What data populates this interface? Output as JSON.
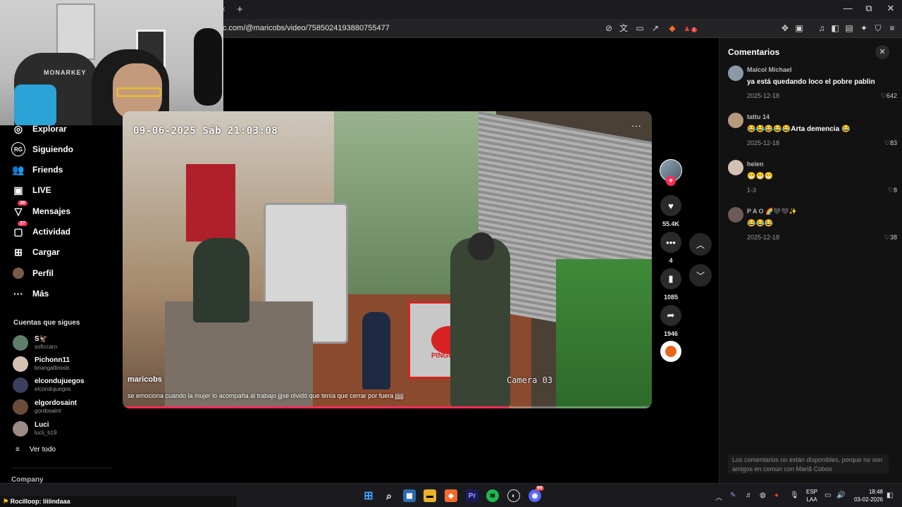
{
  "browser": {
    "url": "c.com/@maricobs/video/7585024193880755477",
    "new_tab": "+",
    "tab_close": "×",
    "window": {
      "minimize": "—",
      "restore": "⧉",
      "close": "✕"
    },
    "ext_badge": "1"
  },
  "webcam": {
    "chair_brand": "MONARKEY"
  },
  "sidebar": {
    "nav": [
      {
        "label": "Explorar",
        "icon": "compass-icon",
        "badge": ""
      },
      {
        "label": "Siguiendo",
        "icon": "following-icon",
        "badge": ""
      },
      {
        "label": "Friends",
        "icon": "friends-icon",
        "badge": ""
      },
      {
        "label": "LIVE",
        "icon": "live-icon",
        "badge": ""
      },
      {
        "label": "Mensajes",
        "icon": "messages-icon",
        "badge": "38"
      },
      {
        "label": "Actividad",
        "icon": "activity-icon",
        "badge": "37"
      },
      {
        "label": "Cargar",
        "icon": "upload-icon",
        "badge": ""
      },
      {
        "label": "Perfil",
        "icon": "profile-icon",
        "badge": ""
      },
      {
        "label": "Más",
        "icon": "more-icon",
        "badge": ""
      }
    ],
    "following_title": "Cuentas que sigues",
    "accounts": [
      {
        "name": "S🦅",
        "username": "soficcaro"
      },
      {
        "name": "Pichonn11",
        "username": "briangallinosb"
      },
      {
        "name": "elcondujuegos",
        "username": "elcondujuegos"
      },
      {
        "name": "elgordosaint",
        "username": "gordosaint"
      },
      {
        "name": "Luci",
        "username": "lucii_b19"
      }
    ],
    "see_all": "Ver todo",
    "company": "Company"
  },
  "video": {
    "timestamp": "09-06-2025 Sáb 21:03:08",
    "camera_label": "Camera 03",
    "store_sign": "PINGUINO",
    "author": "maricobs",
    "caption": "se emociona cuando la mujer lo acompaña al trabajo jjjse olvidó que tenía que cerrar por fuera jjjjjj",
    "progress": 0.73,
    "more": "···"
  },
  "actions": {
    "likes": "55.4K",
    "comments": "4",
    "saves": "1085",
    "shares": "1946",
    "follow": "+"
  },
  "comments_panel": {
    "title": "Comentarios",
    "items": [
      {
        "author": "Maicol Michael",
        "text": "ya está quedando loco el pobre pablin",
        "date": "2025-12-18",
        "likes": "642"
      },
      {
        "author": "tattu 14",
        "text": "😂😂😂😂😂Arta demencia 😂",
        "date": "2025-12-18",
        "likes": "83"
      },
      {
        "author": "helen",
        "text": "😁😁😁",
        "date": "1-3",
        "likes": "8"
      },
      {
        "author": "P A O 🌈🖤🖤✨",
        "text": "😂😂😂",
        "date": "2025-12-18",
        "likes": "38"
      }
    ],
    "note": "Los comentarios no están disponibles, porque no son amigos en común con Mariã Cobos"
  },
  "ticker": {
    "user": "Rocilloop",
    "message": ": liiiindaaa"
  },
  "taskbar": {
    "lang_top": "ESP",
    "lang_bottom": "LAA",
    "time": "18:48",
    "date": "03-02-2026",
    "chat_badge": "99"
  }
}
